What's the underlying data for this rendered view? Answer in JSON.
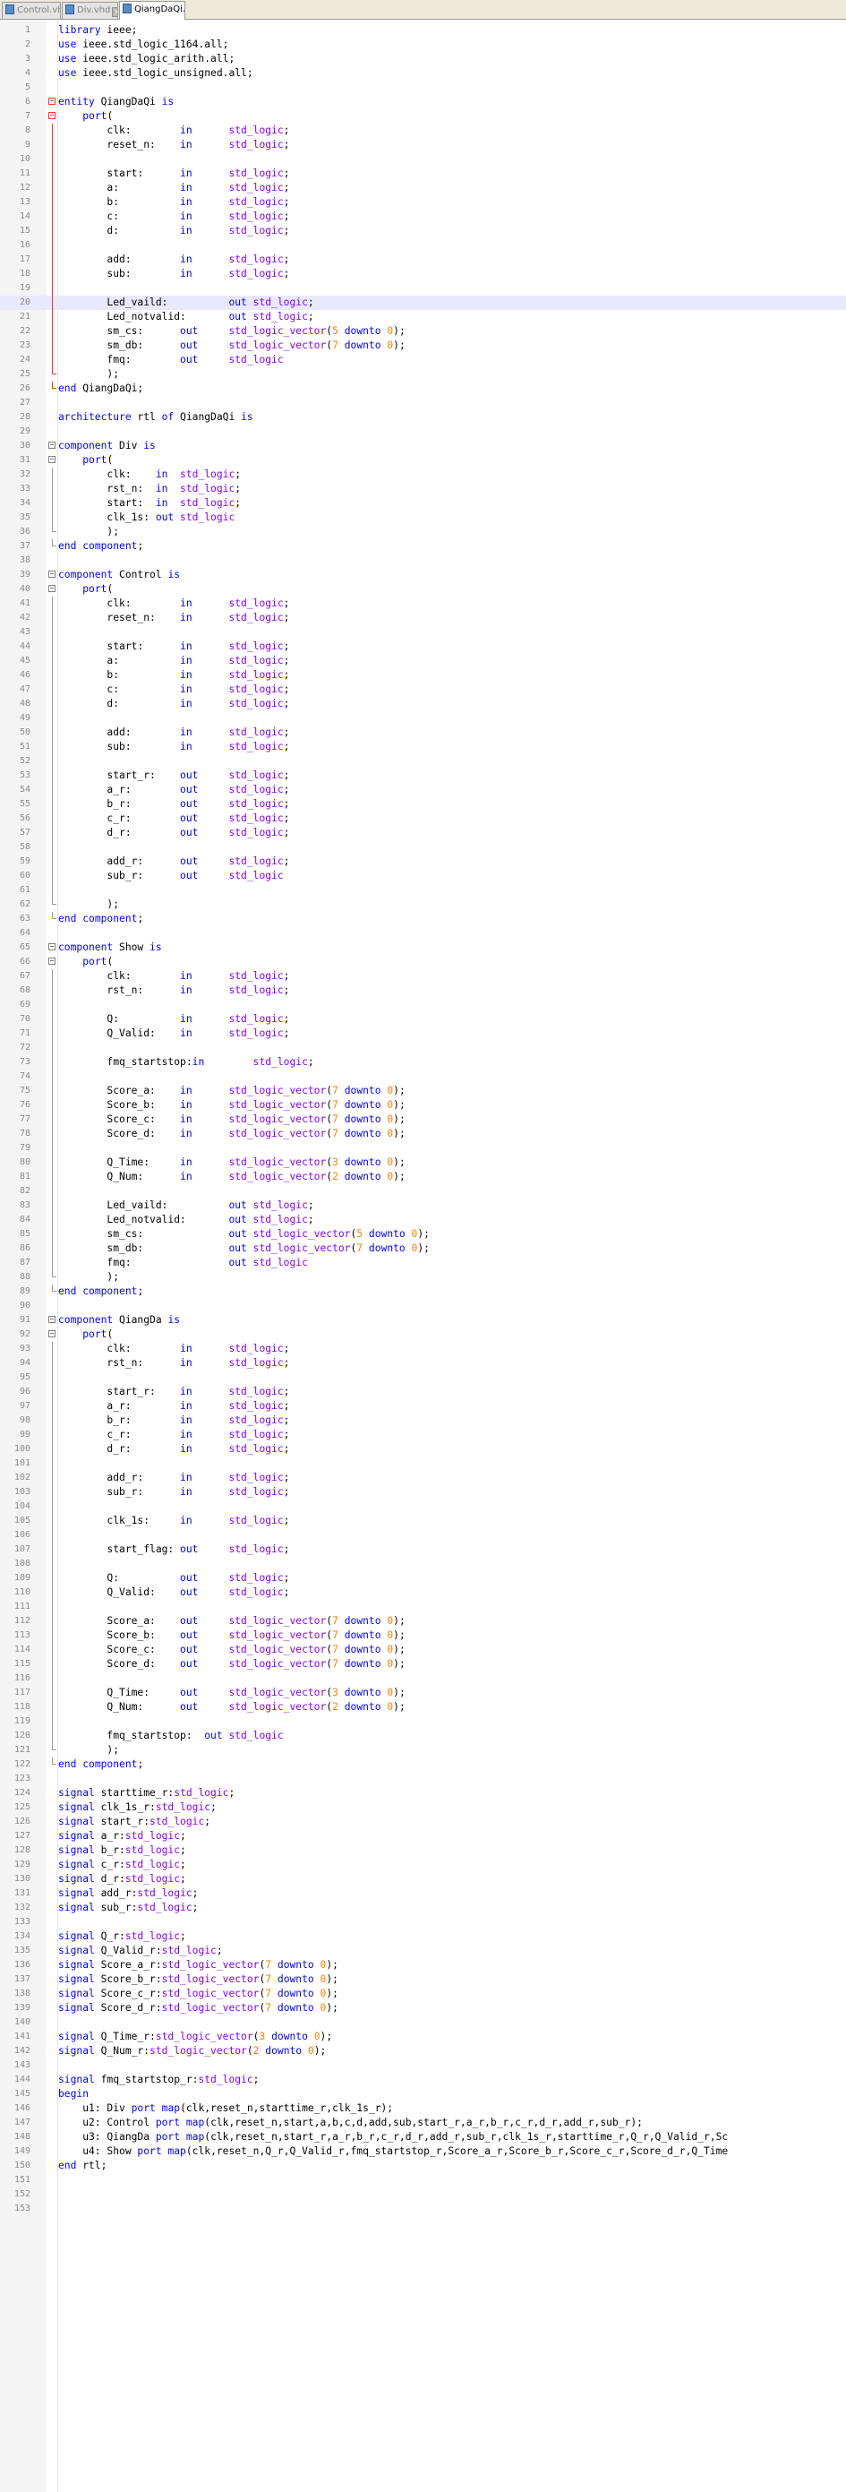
{
  "tabs": [
    {
      "label": "Control.vhd",
      "active": false
    },
    {
      "label": "Div.vhd",
      "active": false
    },
    {
      "label": "QiangDaQi.vhd",
      "active": true
    }
  ],
  "editor": {
    "current_line": 20,
    "lines": [
      "library ieee;",
      "use ieee.std_logic_1164.all;",
      "use ieee.std_logic_arith.all;",
      "use ieee.std_logic_unsigned.all;",
      "",
      "entity QiangDaQi is",
      "    port(",
      "        clk:        in      std_logic;",
      "        reset_n:    in      std_logic;",
      "",
      "        start:      in      std_logic;",
      "        a:          in      std_logic;",
      "        b:          in      std_logic;",
      "        c:          in      std_logic;",
      "        d:          in      std_logic;",
      "",
      "        add:        in      std_logic;",
      "        sub:        in      std_logic;",
      "",
      "        Led_vaild:          out std_logic;",
      "        Led_notvalid:       out std_logic;",
      "        sm_cs:      out     std_logic_vector(5 downto 0);",
      "        sm_db:      out     std_logic_vector(7 downto 0);",
      "        fmq:        out     std_logic",
      "        );",
      "end QiangDaQi;",
      "",
      "architecture rtl of QiangDaQi is",
      "",
      "component Div is",
      "    port(",
      "        clk:    in  std_logic;",
      "        rst_n:  in  std_logic;",
      "        start:  in  std_logic;",
      "        clk_1s: out std_logic",
      "        );",
      "end component;",
      "",
      "component Control is",
      "    port(",
      "        clk:        in      std_logic;",
      "        reset_n:    in      std_logic;",
      "",
      "        start:      in      std_logic;",
      "        a:          in      std_logic;",
      "        b:          in      std_logic;",
      "        c:          in      std_logic;",
      "        d:          in      std_logic;",
      "",
      "        add:        in      std_logic;",
      "        sub:        in      std_logic;",
      "",
      "        start_r:    out     std_logic;",
      "        a_r:        out     std_logic;",
      "        b_r:        out     std_logic;",
      "        c_r:        out     std_logic;",
      "        d_r:        out     std_logic;",
      "",
      "        add_r:      out     std_logic;",
      "        sub_r:      out     std_logic",
      "",
      "        );",
      "end component;",
      "",
      "component Show is",
      "    port(",
      "        clk:        in      std_logic;",
      "        rst_n:      in      std_logic;",
      "",
      "        Q:          in      std_logic;",
      "        Q_Valid:    in      std_logic;",
      "",
      "        fmq_startstop:in        std_logic;",
      "",
      "        Score_a:    in      std_logic_vector(7 downto 0);",
      "        Score_b:    in      std_logic_vector(7 downto 0);",
      "        Score_c:    in      std_logic_vector(7 downto 0);",
      "        Score_d:    in      std_logic_vector(7 downto 0);",
      "",
      "        Q_Time:     in      std_logic_vector(3 downto 0);",
      "        Q_Num:      in      std_logic_vector(2 downto 0);",
      "",
      "        Led_vaild:          out std_logic;",
      "        Led_notvalid:       out std_logic;",
      "        sm_cs:              out std_logic_vector(5 downto 0);",
      "        sm_db:              out std_logic_vector(7 downto 0);",
      "        fmq:                out std_logic",
      "        );",
      "end component;",
      "",
      "component QiangDa is",
      "    port(",
      "        clk:        in      std_logic;",
      "        rst_n:      in      std_logic;",
      "",
      "        start_r:    in      std_logic;",
      "        a_r:        in      std_logic;",
      "        b_r:        in      std_logic;",
      "        c_r:        in      std_logic;",
      "        d_r:        in      std_logic;",
      "",
      "        add_r:      in      std_logic;",
      "        sub_r:      in      std_logic;",
      "",
      "        clk_1s:     in      std_logic;",
      "",
      "        start_flag: out     std_logic;",
      "",
      "        Q:          out     std_logic;",
      "        Q_Valid:    out     std_logic;",
      "",
      "        Score_a:    out     std_logic_vector(7 downto 0);",
      "        Score_b:    out     std_logic_vector(7 downto 0);",
      "        Score_c:    out     std_logic_vector(7 downto 0);",
      "        Score_d:    out     std_logic_vector(7 downto 0);",
      "",
      "        Q_Time:     out     std_logic_vector(3 downto 0);",
      "        Q_Num:      out     std_logic_vector(2 downto 0);",
      "",
      "        fmq_startstop:  out std_logic",
      "        );",
      "end component;",
      "",
      "signal starttime_r:std_logic;",
      "signal clk_1s_r:std_logic;",
      "signal start_r:std_logic;",
      "signal a_r:std_logic;",
      "signal b_r:std_logic;",
      "signal c_r:std_logic;",
      "signal d_r:std_logic;",
      "signal add_r:std_logic;",
      "signal sub_r:std_logic;",
      "",
      "signal Q_r:std_logic;",
      "signal Q_Valid_r:std_logic;",
      "signal Score_a_r:std_logic_vector(7 downto 0);",
      "signal Score_b_r:std_logic_vector(7 downto 0);",
      "signal Score_c_r:std_logic_vector(7 downto 0);",
      "signal Score_d_r:std_logic_vector(7 downto 0);",
      "",
      "signal Q_Time_r:std_logic_vector(3 downto 0);",
      "signal Q_Num_r:std_logic_vector(2 downto 0);",
      "",
      "signal fmq_startstop_r:std_logic;",
      "begin",
      "    u1: Div port map(clk,reset_n,starttime_r,clk_1s_r);",
      "    u2: Control port map(clk,reset_n,start,a,b,c,d,add,sub,start_r,a_r,b_r,c_r,d_r,add_r,sub_r);",
      "    u3: QiangDa port map(clk,reset_n,start_r,a_r,b_r,c_r,d_r,add_r,sub_r,clk_1s_r,starttime_r,Q_r,Q_Valid_r,Sc",
      "    u4: Show port map(clk,reset_n,Q_r,Q_Valid_r,fmq_startstop_r,Score_a_r,Score_b_r,Score_c_r,Score_d_r,Q_Time",
      "end rtl;",
      "",
      "",
      ""
    ]
  }
}
